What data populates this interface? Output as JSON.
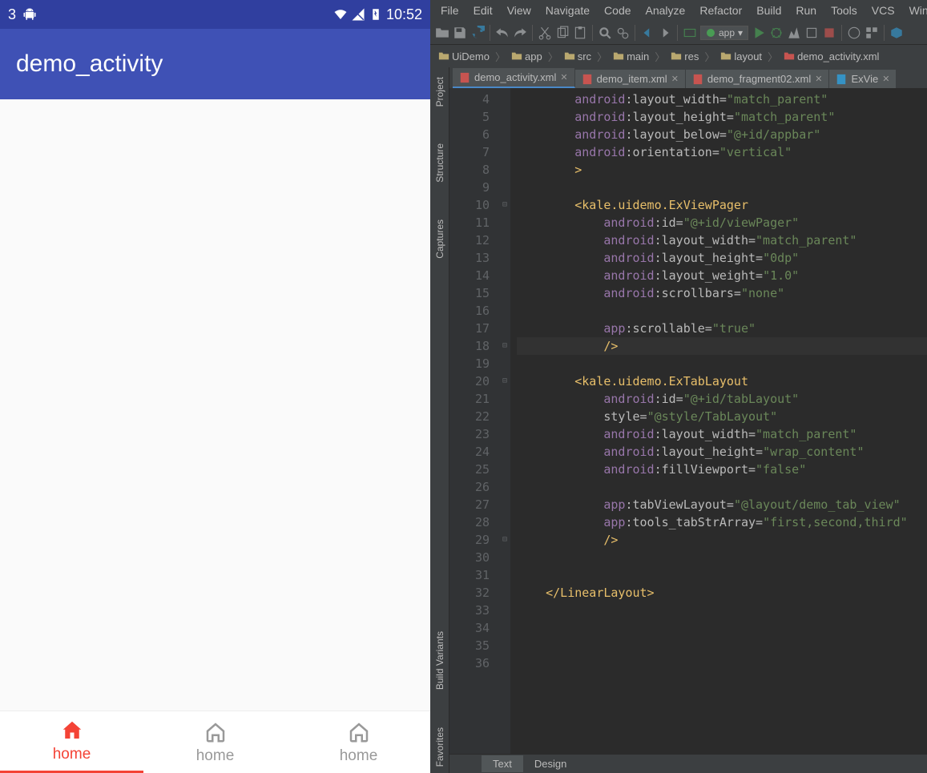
{
  "android": {
    "status": {
      "left_num": "3",
      "time": "10:52"
    },
    "appbar_title": "demo_activity",
    "tabs": [
      "home",
      "home",
      "home"
    ]
  },
  "ide": {
    "menu": [
      "File",
      "Edit",
      "View",
      "Navigate",
      "Code",
      "Analyze",
      "Refactor",
      "Build",
      "Run",
      "Tools",
      "VCS",
      "Window"
    ],
    "app_selector": "app",
    "breadcrumb": [
      "UiDemo",
      "app",
      "src",
      "main",
      "res",
      "layout",
      "demo_activity.xml"
    ],
    "file_tabs": [
      {
        "name": "demo_activity.xml",
        "active": true,
        "type": "xml"
      },
      {
        "name": "demo_item.xml",
        "active": false,
        "type": "xml"
      },
      {
        "name": "demo_fragment02.xml",
        "active": false,
        "type": "xml"
      },
      {
        "name": "ExVie",
        "active": false,
        "type": "java"
      }
    ],
    "side_tabs_top": [
      "Project",
      "Structure",
      "Captures"
    ],
    "side_tabs_bottom": [
      "Build Variants",
      "Favorites"
    ],
    "bottom_tabs": [
      "Text",
      "Design"
    ],
    "code_lines": [
      {
        "n": 4,
        "indent": 2,
        "ns": "android",
        "attr": ":layout_width=",
        "val": "\"match_parent\""
      },
      {
        "n": 5,
        "indent": 2,
        "ns": "android",
        "attr": ":layout_height=",
        "val": "\"match_parent\""
      },
      {
        "n": 6,
        "indent": 2,
        "ns": "android",
        "attr": ":layout_below=",
        "val": "\"@+id/appbar\""
      },
      {
        "n": 7,
        "indent": 2,
        "ns": "android",
        "attr": ":orientation=",
        "val": "\"vertical\""
      },
      {
        "n": 8,
        "indent": 2,
        "tag_text": ">"
      },
      {
        "n": 9,
        "blank": true
      },
      {
        "n": 10,
        "indent": 2,
        "tag_text": "<kale.uidemo.ExViewPager",
        "fold": "-"
      },
      {
        "n": 11,
        "indent": 3,
        "ns": "android",
        "attr": ":id=",
        "val": "\"@+id/viewPager\""
      },
      {
        "n": 12,
        "indent": 3,
        "ns": "android",
        "attr": ":layout_width=",
        "val": "\"match_parent\""
      },
      {
        "n": 13,
        "indent": 3,
        "ns": "android",
        "attr": ":layout_height=",
        "val": "\"0dp\""
      },
      {
        "n": 14,
        "indent": 3,
        "ns": "android",
        "attr": ":layout_weight=",
        "val": "\"1.0\""
      },
      {
        "n": 15,
        "indent": 3,
        "ns": "android",
        "attr": ":scrollbars=",
        "val": "\"none\""
      },
      {
        "n": 16,
        "blank": true
      },
      {
        "n": 17,
        "indent": 3,
        "ns": "app",
        "attr": ":scrollable=",
        "val": "\"true\""
      },
      {
        "n": 18,
        "indent": 3,
        "tag_text": "/>",
        "fold": "-",
        "hl": true
      },
      {
        "n": 19,
        "blank": true
      },
      {
        "n": 20,
        "indent": 2,
        "tag_text": "<kale.uidemo.ExTabLayout",
        "fold": "-"
      },
      {
        "n": 21,
        "indent": 3,
        "ns": "android",
        "attr": ":id=",
        "val": "\"@+id/tabLayout\""
      },
      {
        "n": 22,
        "indent": 3,
        "attr": "style=",
        "val": "\"@style/TabLayout\""
      },
      {
        "n": 23,
        "indent": 3,
        "ns": "android",
        "attr": ":layout_width=",
        "val": "\"match_parent\""
      },
      {
        "n": 24,
        "indent": 3,
        "ns": "android",
        "attr": ":layout_height=",
        "val": "\"wrap_content\""
      },
      {
        "n": 25,
        "indent": 3,
        "ns": "android",
        "attr": ":fillViewport=",
        "val": "\"false\""
      },
      {
        "n": 26,
        "blank": true
      },
      {
        "n": 27,
        "indent": 3,
        "ns": "app",
        "attr": ":tabViewLayout=",
        "val": "\"@layout/demo_tab_view\""
      },
      {
        "n": 28,
        "indent": 3,
        "ns": "app",
        "attr": ":tools_tabStrArray=",
        "val": "\"first,second,third\""
      },
      {
        "n": 29,
        "indent": 3,
        "tag_text": "/>",
        "fold": "-"
      },
      {
        "n": 30,
        "blank": true
      },
      {
        "n": 31,
        "blank": true
      },
      {
        "n": 32,
        "indent": 1,
        "tag_text": "</LinearLayout>"
      },
      {
        "n": 33,
        "blank": true
      },
      {
        "n": 34,
        "blank": true
      },
      {
        "n": 35,
        "blank": true
      },
      {
        "n": 36,
        "blank": true
      }
    ]
  }
}
